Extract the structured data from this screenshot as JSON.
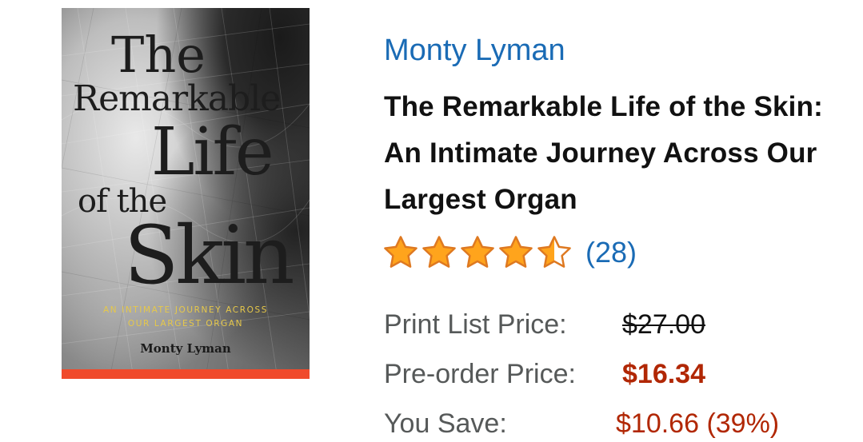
{
  "product": {
    "author": "Monty Lyman",
    "title": "The Remarkable Life of the Skin: An Intimate Journey Across Our Largest Organ",
    "rating": {
      "stars": 4.5,
      "max_stars": 5,
      "count_label": "(28)"
    },
    "prices": {
      "list_label": "Print List Price:",
      "list_value": "$27.00",
      "preorder_label": "Pre-order Price:",
      "preorder_value": "$16.34",
      "save_label": "You Save:",
      "save_value": "$10.66 (39%)"
    }
  },
  "cover": {
    "line1": "The",
    "line2": "Remarkable",
    "line3": "Life",
    "line4": "of the",
    "line5": "Skin",
    "subtitle1": "An Intimate Journey Across",
    "subtitle2": "Our Largest Organ",
    "author": "Monty Lyman"
  },
  "colors": {
    "link": "#1a6bb5",
    "price_red": "#b12704",
    "star_fill": "#ffa41c",
    "star_stroke": "#de7921",
    "cover_band": "#f04a2b",
    "cover_subtitle": "#e6c84a"
  }
}
